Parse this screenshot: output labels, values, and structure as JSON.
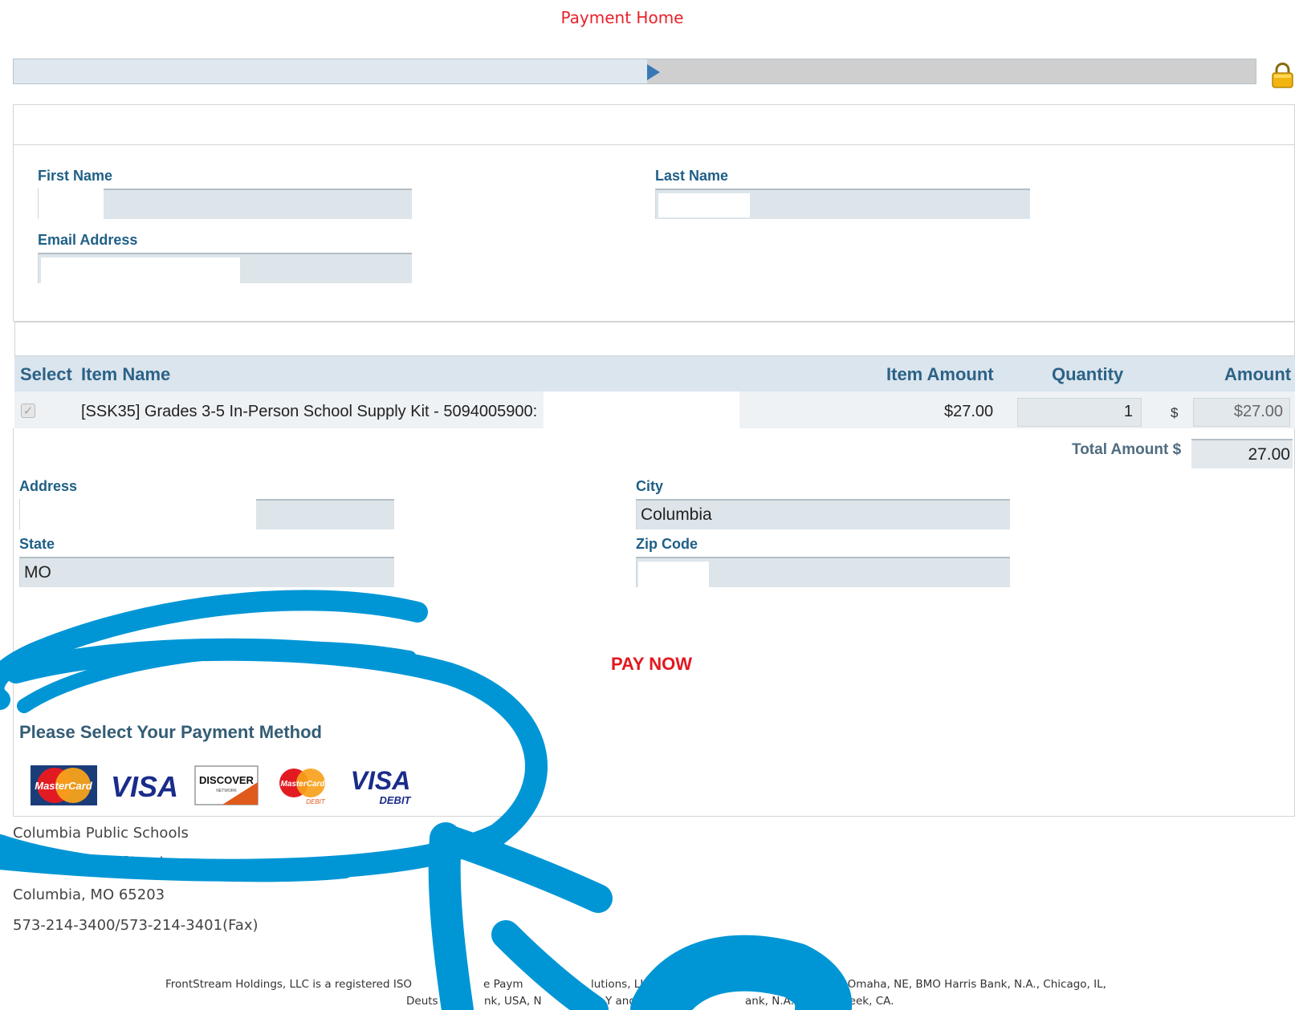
{
  "nav": {
    "title": "Payment Home"
  },
  "progress": {
    "fraction": 0.51
  },
  "contact": {
    "first_name_label": "First Name",
    "last_name_label": "Last Name",
    "email_label": "Email Address"
  },
  "items": {
    "headers": {
      "select": "Select",
      "item_name": "Item Name",
      "item_amount": "Item Amount",
      "quantity": "Quantity",
      "amount": "Amount"
    },
    "rows": [
      {
        "name": "[SSK35] Grades 3-5 In-Person School Supply Kit - 5094005900:",
        "item_amount": "$27.00",
        "quantity": "1",
        "currency": "$",
        "amount": "$27.00",
        "checked": true
      }
    ],
    "total_label": "Total Amount $",
    "total_value": "27.00"
  },
  "address": {
    "address_label": "Address",
    "city_label": "City",
    "city_value": "Columbia",
    "state_label": "State",
    "state_value": "MO",
    "zip_label": "Zip Code"
  },
  "actions": {
    "pay_now": "PAY NOW"
  },
  "payment": {
    "title": "Please Select Your Payment Method",
    "cards": [
      {
        "id": "mastercard",
        "text": "MasterCard"
      },
      {
        "id": "visa",
        "text": "VISA"
      },
      {
        "id": "discover",
        "text": "DISCOVER",
        "sub": "NETWORK"
      },
      {
        "id": "mastercard-debit",
        "text": "MasterCard",
        "sub": "DEBIT"
      },
      {
        "id": "visa-debit",
        "text": "VISA",
        "sub": "DEBIT"
      }
    ]
  },
  "footer": {
    "org": "Columbia Public Schools",
    "street_partial": "1818",
    "street_tail": "Street",
    "city_line": "Columbia, MO 65203",
    "phone": "573-214-3400/573-214-3401(Fax)",
    "legal_line1_a": "FrontStream Holdings, LLC is a registered ISO",
    "legal_line1_b": "e Paym",
    "legal_line1_c": "lutions, LLC, Fi",
    "legal_line1_d": "aha, Omaha, NE, BMO Harris Bank, N.A., Chicago, IL,",
    "legal_line2_a": "Deuts",
    "legal_line2_b": "nk, USA, N",
    "legal_line2_c": "Y and We",
    "legal_line2_d": "ank, N.A.,",
    "legal_line2_e": "Creek, CA."
  },
  "colors": {
    "accent_red": "#e8222a",
    "label_blue": "#1f5f86",
    "annotation_blue": "#0096d6"
  },
  "icons": {
    "lock": "lock-icon",
    "progress_marker": "play-triangle-icon"
  }
}
